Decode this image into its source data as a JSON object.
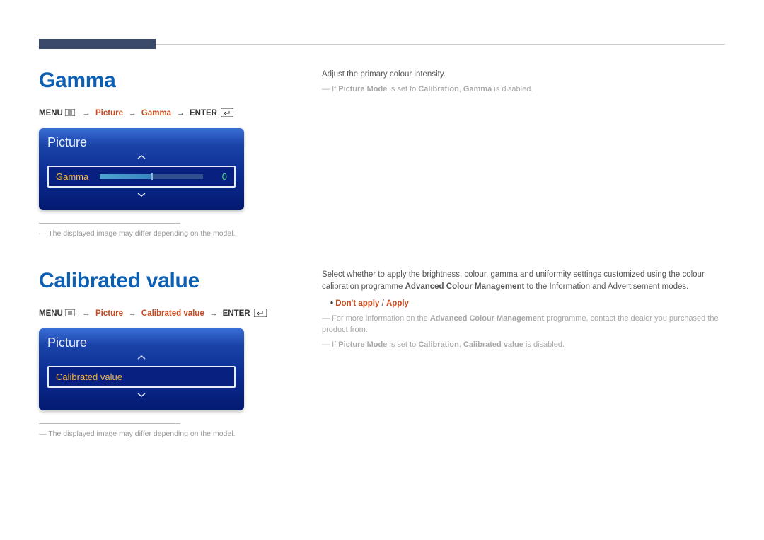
{
  "gamma": {
    "heading": "Gamma",
    "path": {
      "menu": "MENU",
      "seg1": "Picture",
      "seg2": "Gamma",
      "enter": "ENTER"
    },
    "osd": {
      "title": "Picture",
      "label": "Gamma",
      "value": "0"
    },
    "footnote": "The displayed image may differ depending on the model.",
    "right": {
      "l1": "Adjust the primary colour intensity.",
      "note_prefix": "If ",
      "note_pm": "Picture Mode",
      "note_mid": " is set to ",
      "note_cal": "Calibration",
      "note_comma": ", ",
      "note_gamma": "Gamma",
      "note_end": " is disabled."
    }
  },
  "calibrated": {
    "heading": "Calibrated value",
    "path": {
      "menu": "MENU",
      "seg1": "Picture",
      "seg2": "Calibrated value",
      "enter": "ENTER"
    },
    "osd": {
      "title": "Picture",
      "label": "Calibrated value"
    },
    "footnote": "The displayed image may differ depending on the model.",
    "right": {
      "p1a": "Select whether to apply the brightness, colour, gamma and uniformity settings customized using the colour calibration programme ",
      "p1b": "Advanced Colour Management",
      "p1c": " to the Information and Advertisement modes.",
      "opt1": "Don't apply",
      "opt_sep": " / ",
      "opt2": "Apply",
      "n1a": "For more information on the ",
      "n1b": "Advanced Colour Management",
      "n1c": " programme, contact the dealer you purchased the product from.",
      "n2_prefix": "If ",
      "n2_pm": "Picture Mode",
      "n2_mid": " is set to ",
      "n2_cal": "Calibration",
      "n2_comma": ", ",
      "n2_cv": "Calibrated value",
      "n2_end": " is disabled."
    }
  }
}
